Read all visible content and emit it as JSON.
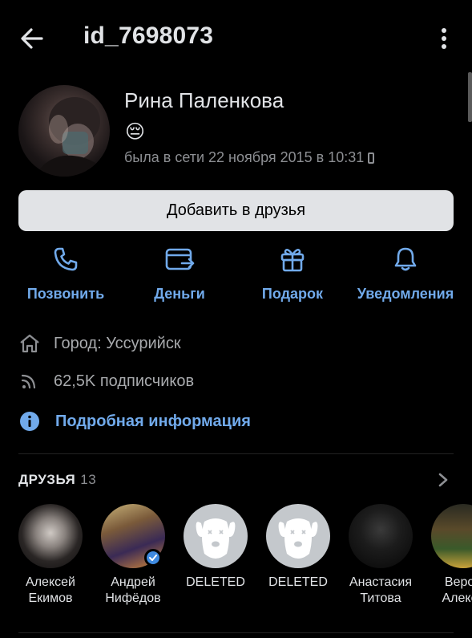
{
  "header": {
    "title": "id_7698073"
  },
  "profile": {
    "name": "Рина Паленкова",
    "status_emoji": "😔",
    "last_seen": "была в сети 22 ноября 2015 в 10:31"
  },
  "add_friend_label": "Добавить в друзья",
  "actions": [
    {
      "label": "Позвонить",
      "icon": "phone-icon"
    },
    {
      "label": "Деньги",
      "icon": "money-card-icon"
    },
    {
      "label": "Подарок",
      "icon": "gift-icon"
    },
    {
      "label": "Уведомления",
      "icon": "bell-icon"
    }
  ],
  "info": {
    "city": "Город: Уссурийск",
    "followers": "62,5K подписчиков",
    "details_link": "Подробная информация"
  },
  "friends": {
    "title": "ДРУЗЬЯ",
    "count": "13",
    "items": [
      {
        "line1": "Алексей",
        "line2": "Екимов"
      },
      {
        "line1": "Андрей",
        "line2": "Нифёдов"
      },
      {
        "line1": "DELETED",
        "line2": ""
      },
      {
        "line1": "DELETED",
        "line2": ""
      },
      {
        "line1": "Анастасия",
        "line2": "Титова"
      },
      {
        "line1": "Верон",
        "line2": "Алекса"
      }
    ]
  },
  "colors": {
    "accent": "#71aaeb",
    "background": "#000000",
    "button_bg": "#e1e3e6",
    "secondary_text": "#8d8f93"
  }
}
